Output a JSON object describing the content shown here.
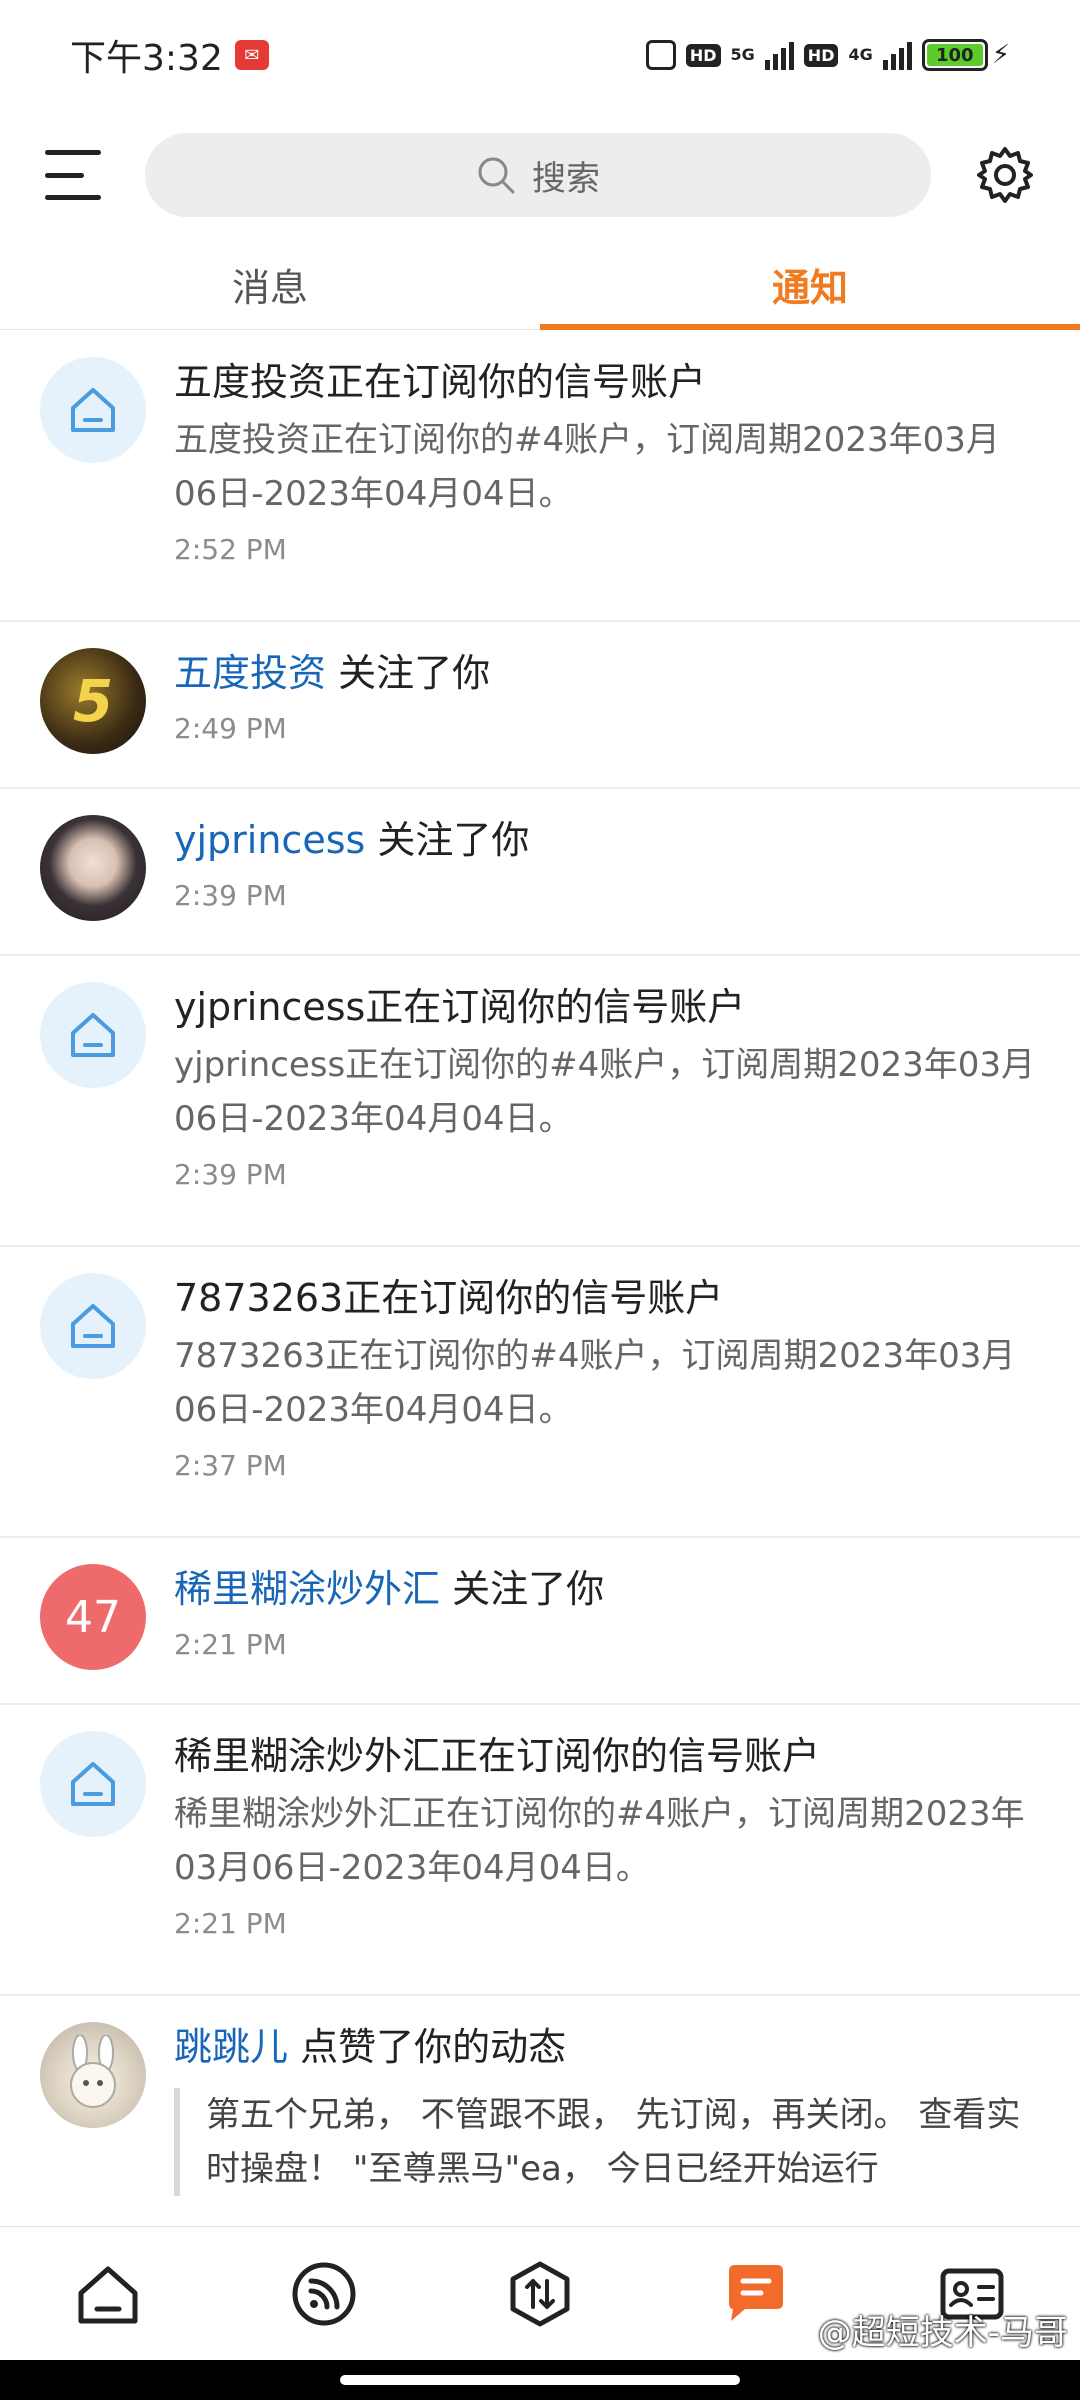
{
  "status_bar": {
    "time": "下午3:32",
    "network_a": "5G",
    "network_b": "4G",
    "hd_a": "HD",
    "hd_b": "HD",
    "battery": "100"
  },
  "header": {
    "search_placeholder": "搜索"
  },
  "tabs": [
    {
      "label": "消息",
      "active": false
    },
    {
      "label": "通知",
      "active": true
    }
  ],
  "notifications": [
    {
      "type": "subscription",
      "title": "五度投资正在订阅你的信号账户",
      "desc": "五度投资正在订阅你的#4账户，订阅周期2023年03月06日-2023年04月04日。",
      "time": "2:52 PM"
    },
    {
      "type": "follow",
      "name": "五度投资",
      "action": " 关注了你",
      "time": "2:49 PM",
      "avatar_text": "5"
    },
    {
      "type": "follow",
      "name": "yjprincess",
      "action": " 关注了你",
      "time": "2:39 PM"
    },
    {
      "type": "subscription",
      "title": "yjprincess正在订阅你的信号账户",
      "desc": "yjprincess正在订阅你的#4账户，订阅周期2023年03月06日-2023年04月04日。",
      "time": "2:39 PM"
    },
    {
      "type": "subscription",
      "title": "7873263正在订阅你的信号账户",
      "desc": "7873263正在订阅你的#4账户，订阅周期2023年03月06日-2023年04月04日。",
      "time": "2:37 PM"
    },
    {
      "type": "follow",
      "name": "稀里糊涂炒外汇",
      "action": " 关注了你",
      "time": "2:21 PM",
      "avatar_text": "47"
    },
    {
      "type": "subscription",
      "title": "稀里糊涂炒外汇正在订阅你的信号账户",
      "desc": "稀里糊涂炒外汇正在订阅你的#4账户，订阅周期2023年03月06日-2023年04月04日。",
      "time": "2:21 PM"
    },
    {
      "type": "like",
      "name": "跳跳儿",
      "action": " 点赞了你的动态",
      "quote": "第五个兄弟， 不管跟不跟， 先订阅，再关闭。 查看实时操盘！ \"至尊黑马\"ea， 今日已经开始运行"
    }
  ],
  "watermark": "@超短技术-马哥",
  "colors": {
    "accent": "#ef7a1f",
    "link": "#1766b8",
    "house_icon": "#4a9be0"
  }
}
